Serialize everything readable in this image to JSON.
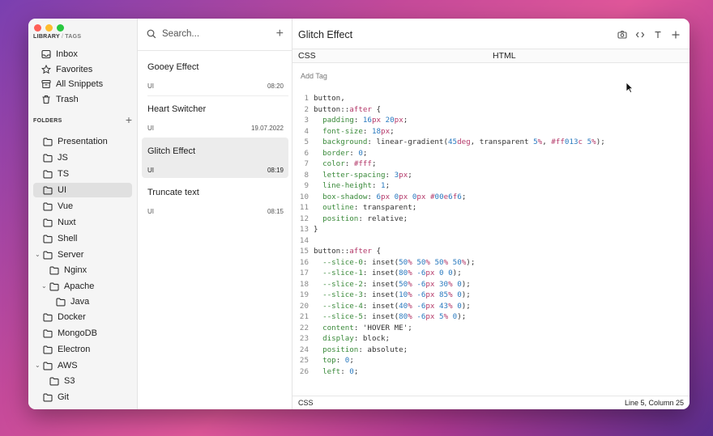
{
  "colors": {
    "close": "#ff5f57",
    "minimize": "#febc2e",
    "zoom": "#28c840",
    "active_bg": "#e0e0e0"
  },
  "sidebar": {
    "library_label": "LIBRARY",
    "tags_label": "TAGS",
    "nav": [
      {
        "label": "Inbox",
        "icon": "inbox-icon"
      },
      {
        "label": "Favorites",
        "icon": "star-icon"
      },
      {
        "label": "All Snippets",
        "icon": "archive-icon"
      },
      {
        "label": "Trash",
        "icon": "trash-icon"
      }
    ],
    "folders_label": "FOLDERS",
    "folders": [
      {
        "label": "Presentation"
      },
      {
        "label": "JS"
      },
      {
        "label": "TS"
      },
      {
        "label": "UI",
        "active": true
      },
      {
        "label": "Vue"
      },
      {
        "label": "Nuxt"
      },
      {
        "label": "Shell"
      },
      {
        "label": "Server",
        "expanded": true
      },
      {
        "label": "Nginx"
      },
      {
        "label": "Apache",
        "expanded": true
      },
      {
        "label": "Java"
      },
      {
        "label": "Docker"
      },
      {
        "label": "MongoDB"
      },
      {
        "label": "Electron"
      },
      {
        "label": "AWS",
        "expanded": true
      },
      {
        "label": "S3"
      },
      {
        "label": "Git"
      }
    ]
  },
  "list": {
    "search_placeholder": "Search...",
    "snippets": [
      {
        "name": "Gooey Effect",
        "folder": "UI",
        "date": "08:20"
      },
      {
        "name": "Heart Switcher",
        "folder": "UI",
        "date": "19.07.2022"
      },
      {
        "name": "Glitch Effect",
        "folder": "UI",
        "date": "08:19",
        "active": true
      },
      {
        "name": "Truncate text",
        "folder": "UI",
        "date": "08:15"
      }
    ]
  },
  "editor": {
    "title": "Glitch Effect",
    "tabs": [
      "CSS",
      "HTML"
    ],
    "add_tag": "Add Tag",
    "language": "CSS",
    "cursor_position": "Line 5, Column 25",
    "code_lines": [
      "button,",
      "button::after {",
      "  padding: 16px 20px;",
      "  font-size: 18px;",
      "  background: linear-gradient(45deg, transparent 5%, #ff013c 5%);",
      "  border: 0;",
      "  color: #fff;",
      "  letter-spacing: 3px;",
      "  line-height: 1;",
      "  box-shadow: 6px 0px 0px #00e6f6;",
      "  outline: transparent;",
      "  position: relative;",
      "}",
      "",
      "button::after {",
      "  --slice-0: inset(50% 50% 50% 50%);",
      "  --slice-1: inset(80% -6px 0 0);",
      "  --slice-2: inset(50% -6px 30% 0);",
      "  --slice-3: inset(10% -6px 85% 0);",
      "  --slice-4: inset(40% -6px 43% 0);",
      "  --slice-5: inset(80% -6px 5% 0);",
      "  content: 'HOVER ME';",
      "  display: block;",
      "  position: absolute;",
      "  top: 0;",
      "  left: 0;"
    ]
  }
}
